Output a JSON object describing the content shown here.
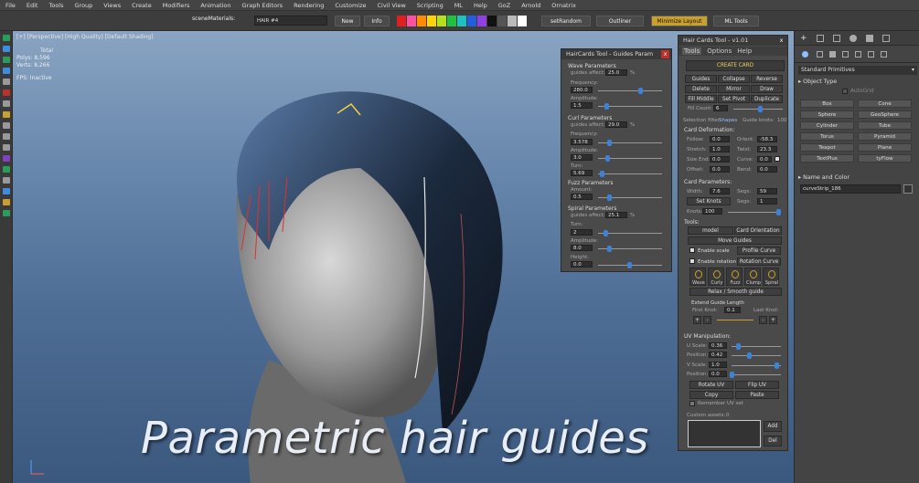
{
  "menubar": [
    "File",
    "Edit",
    "Tools",
    "Group",
    "Views",
    "Create",
    "Modifiers",
    "Animation",
    "Graph Editors",
    "Rendering",
    "Customize",
    "Civil View",
    "Scripting",
    "ML",
    "Help",
    "GoZ",
    "Arnold",
    "Ornatrix"
  ],
  "toolbar": {
    "scene_label": "sceneMaterials:",
    "scene_value": "HAIR #4",
    "new": "New",
    "info": "Info",
    "set_random": "setRandom",
    "outliner": "Outliner",
    "minimize": "Minimize Layout",
    "ml_tools": "ML Tools",
    "swatches": [
      "#e02020",
      "#ff4fa0",
      "#ff8c00",
      "#ffd400",
      "#b4e020",
      "#20c040",
      "#20c0c0",
      "#2060e0",
      "#9040e0",
      "#111111",
      "#555555",
      "#bbbbbb",
      "#ffffff"
    ]
  },
  "viewport": {
    "label": "[+] [Perspective] [High Quality] [Default Shading]",
    "stats": {
      "total": "Total",
      "polys": "Polys: 8,596",
      "verts": "Verts: 8,266",
      "fps": "FPS: Inactive"
    },
    "overlay": "Parametric hair guides"
  },
  "guides_panel": {
    "title": "HairCards Tool - Guides Param",
    "close": "x",
    "wave": {
      "title": "Wave Parameters",
      "affect_label": "guides affect:",
      "affect": "25.0",
      "pct": "%",
      "freq_label": "Frequency:",
      "freq": "280.0",
      "amp_label": "Amplitude:",
      "amp": "1.5"
    },
    "curl": {
      "title": "Curl Parameters",
      "affect_label": "guides affect:",
      "affect": "29.0",
      "pct": "%",
      "freq_label": "Frequency:",
      "freq": "3.578",
      "amp_label": "Amplitude:",
      "amp": "3.0",
      "turn_label": "Turn:",
      "turn": "5.69"
    },
    "fuzz": {
      "title": "Fuzz Parameters",
      "amount_label": "Amount:",
      "amount": "0.5"
    },
    "spiral": {
      "title": "Spiral Parameters",
      "affect_label": "guides affect:",
      "affect": "25.1",
      "pct": "%",
      "turn_label": "Turn:",
      "turn": "2",
      "amp_label": "Amplitude:",
      "amp": "8.0",
      "height_label": "Height:",
      "height": "0.0"
    }
  },
  "hc_panel": {
    "title": "Hair Cards Tool - v1.01",
    "close": "x",
    "menu": [
      "Tools",
      "Options",
      "Help"
    ],
    "create_card": "CREATE CARD",
    "row1": [
      "Guides",
      "Collapse",
      "Reverse"
    ],
    "row2": [
      "Delete",
      "Mirror",
      "Draw"
    ],
    "row3": [
      "Fill Middle",
      "Set Pivot",
      "Duplicate"
    ],
    "fill_count_label": "Fill Count:",
    "fill_count": "6",
    "selection_filter": "Selection filter:",
    "filter_value": "Shapes",
    "guide_knots": "Guide knots:",
    "guide_knots_val": "100",
    "card_deform": "Card Deformation:",
    "follow": "Follow:",
    "follow_v": "0.0",
    "orient": "Orient:",
    "orient_v": "-58.3",
    "stretch": "Stretch:",
    "stretch_v": "1.0",
    "twist": "Twist:",
    "twist_v": "23.3",
    "sizeend": "Size End:",
    "sizeend_v": "0.0",
    "curve": "Curve:",
    "curve_v": "0.0",
    "offset": "Offset:",
    "offset_v": "0.0",
    "bend": "Bend:",
    "bend_v": "0.0",
    "card_params": "Card Parameters:",
    "width": "Width:",
    "width_v": "7.6",
    "segs": "Segs:",
    "segs_v": "59",
    "set_knots": "Set Knots",
    "segs2": "Segs:",
    "segs2_v": "1",
    "knots": "Knots:",
    "knots_v": "100",
    "tools": "Tools:",
    "model": "model",
    "card_orient": "Card Orientation",
    "move_guides": "Move Guides",
    "enable_scale": "Enable scale",
    "profile_curve": "Profile Curve",
    "enable_rotation": "Enable rotation",
    "rotation_curve": "Rotation Curve",
    "icons": [
      "Wave",
      "Curly",
      "Fuzz",
      "Clump",
      "Spiral"
    ],
    "relax": "Relax / Smooth guide",
    "extend": "Extend Guide Length",
    "first_knot": "First Knot:",
    "last_knot": "Last Knot:",
    "ext_val": "0.1",
    "plus": "+",
    "minus": "-",
    "uv": "UV Manipulation:",
    "uscale": "U Scale:",
    "uscale_v": "0.36",
    "upos": "Position:",
    "upos_v": "0.42",
    "vscale": "V Scale:",
    "vscale_v": "1.0",
    "vpos": "Position:",
    "vpos_v": "0.0",
    "rotate_uv": "Rotate UV",
    "flip_uv": "Flip UV",
    "copy": "Copy",
    "paste": "Paste",
    "remember_uv": "Remember UV set",
    "custom_assets": "Custom assets:",
    "custom_count": "0",
    "add": "Add",
    "del": "Del"
  },
  "right_panel": {
    "dropdown": "Standard Primitives",
    "object_type": "Object Type",
    "autogrid": "AutoGrid",
    "objects": [
      "Box",
      "Cone",
      "Sphere",
      "GeoSphere",
      "Cylinder",
      "Tube",
      "Torus",
      "Pyramid",
      "Teapot",
      "Plane",
      "TextPlus",
      "tyFlow"
    ],
    "name_color": "Name and Color",
    "name_value": "curveStrip_186"
  }
}
